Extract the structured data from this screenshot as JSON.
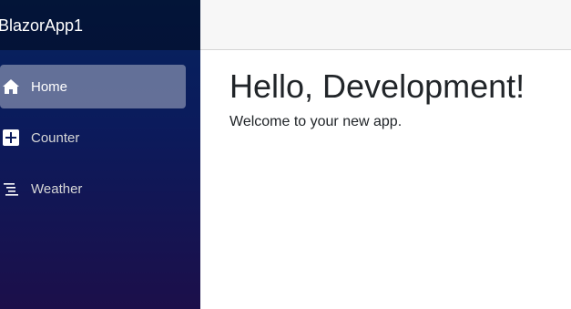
{
  "app": {
    "brand": "BlazorApp1"
  },
  "nav": {
    "items": [
      {
        "label": "Home",
        "icon": "home-icon",
        "active": true
      },
      {
        "label": "Counter",
        "icon": "plus-square-icon",
        "active": false
      },
      {
        "label": "Weather",
        "icon": "list-icon",
        "active": false
      }
    ]
  },
  "page": {
    "title": "Hello, Development!",
    "text": "Welcome to your new app."
  },
  "colors": {
    "sidebar_top": "#05235e",
    "sidebar_bottom": "#1c0f4a",
    "active_item_bg": "rgba(255,255,255,0.37)",
    "topbar_bg": "#f7f7f7",
    "text_main": "#212529"
  }
}
